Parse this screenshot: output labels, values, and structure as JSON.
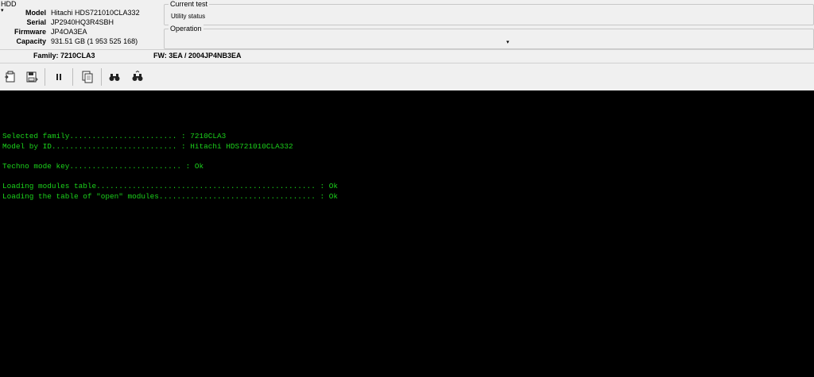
{
  "hdd": {
    "legend": "HDD",
    "rows": [
      {
        "label": "Model",
        "value": "Hitachi HDS721010CLA332"
      },
      {
        "label": "Serial",
        "value": "JP2940HQ3R4SBH"
      },
      {
        "label": "Firmware",
        "value": "JP4OA3EA"
      },
      {
        "label": "Capacity",
        "value": "931.51 GB (1 953 525 168)"
      }
    ]
  },
  "current_test": {
    "legend": "Current test",
    "value": "Utility status"
  },
  "operation": {
    "legend": "Operation",
    "value": ""
  },
  "family_bar": {
    "family": "Family: 7210CLA3",
    "fw": "FW:  3EA / 2004JP4NB3EA"
  },
  "toolbar": {
    "icons": [
      "load-icon",
      "save-icon",
      "pause-icon",
      "copy-icon",
      "find-icon",
      "find-next-icon"
    ]
  },
  "terminal": {
    "lines": [
      "Selected family........................ : 7210CLA3",
      "Model by ID............................ : Hitachi HDS721010CLA332",
      "",
      "Techno mode key......................... : Ok",
      "",
      "Loading modules table................................................. : Ok",
      "Loading the table of \"open\" modules................................... : Ok"
    ]
  },
  "colors": {
    "terminal_bg": "#000000",
    "terminal_text": "#1bd21b",
    "window_bg": "#f0f0f0"
  }
}
